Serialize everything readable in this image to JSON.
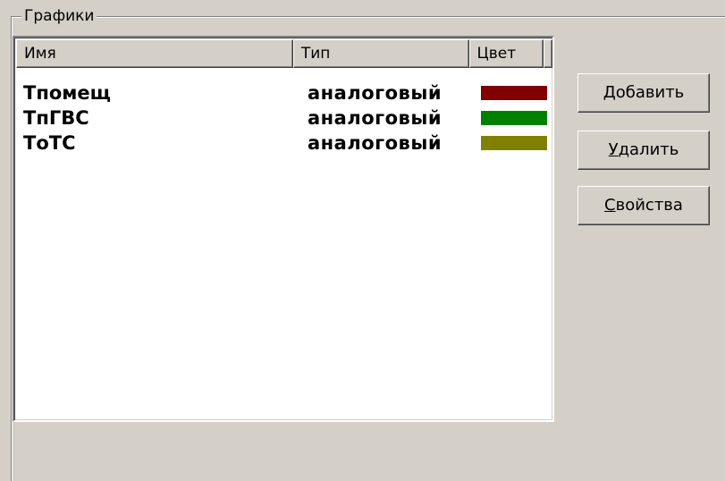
{
  "groupbox": {
    "title": "Графики"
  },
  "listview": {
    "columns": [
      "Имя",
      "Тип",
      "Цвет"
    ],
    "rows": [
      {
        "name": "Тпомещ",
        "type": "аналоговый",
        "color": "#800000"
      },
      {
        "name": "ТпГВС",
        "type": "аналоговый",
        "color": "#008000"
      },
      {
        "name": "ТоТС",
        "type": "аналоговый",
        "color": "#808000"
      }
    ]
  },
  "buttons": {
    "add": {
      "mnemonic": "Д",
      "rest": "обавить"
    },
    "delete": {
      "mnemonic": "У",
      "rest": "далить"
    },
    "properties": {
      "mnemonic": "С",
      "rest": "войства"
    }
  }
}
